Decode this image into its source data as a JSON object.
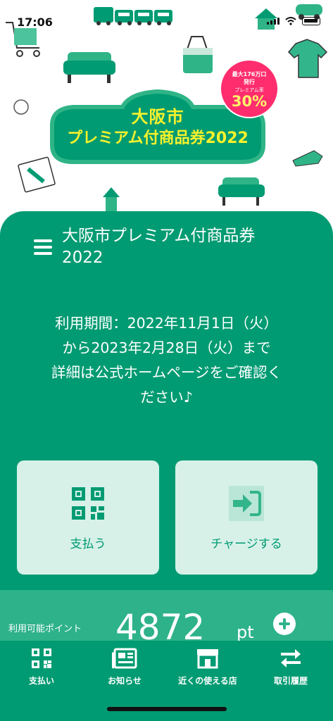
{
  "status_bar": {
    "time": "17:06"
  },
  "hero": {
    "logo_line1": "大阪市",
    "logo_line2": "プレミアム付商品券2022",
    "badge_line1": "最大176万口",
    "badge_line2": "発行",
    "badge_line3": "プレミアム率",
    "badge_value": "30%"
  },
  "header": {
    "title": "大阪市プレミアム付商品券2022"
  },
  "notice": {
    "line1": "利用期間：2022年11月1日（火）",
    "line2": "から2023年2月28日（火）まで",
    "line3": "詳細は公式ホームページをご確認く",
    "line4": "ださい♪"
  },
  "actions": {
    "pay_label": "支払う",
    "charge_label": "チャージする"
  },
  "points": {
    "label": "利用可能ポイント",
    "value": "4872",
    "unit": "pt"
  },
  "nav": {
    "items": [
      {
        "label": "支払い",
        "icon": "qr-code-icon"
      },
      {
        "label": "お知らせ",
        "icon": "newspaper-icon"
      },
      {
        "label": "近くの使える店",
        "icon": "store-icon"
      },
      {
        "label": "取引履歴",
        "icon": "swap-arrows-icon"
      }
    ]
  },
  "colors": {
    "brand_green": "#009b72",
    "card_bg": "#d7f1e9",
    "points_strip": "#2eb28a",
    "logo_yellow": "#f7f12c",
    "badge_pink": "#ff2d6e"
  }
}
